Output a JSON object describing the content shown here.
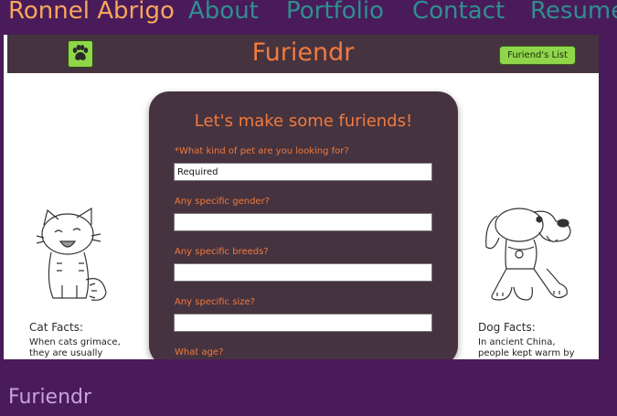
{
  "site": {
    "brand": "Ronnel Abrigo",
    "nav": [
      "About",
      "Portfolio",
      "Contact",
      "Resume"
    ]
  },
  "app": {
    "title": "Furiendr",
    "list_button": "Furiend's List"
  },
  "form": {
    "title": "Let's make some furiends!",
    "fields": [
      {
        "label": "*What kind of pet are you looking for?",
        "value": "Required"
      },
      {
        "label": "Any specific gender?",
        "value": ""
      },
      {
        "label": "Any specific breeds?",
        "value": ""
      },
      {
        "label": "Any specific size?",
        "value": ""
      },
      {
        "label": "What age?",
        "value": ""
      }
    ]
  },
  "cat_facts": {
    "title": "Cat Facts:",
    "text_line1": "When cats grimace,",
    "text_line2": "they are usually"
  },
  "dog_facts": {
    "title": "Dog Facts:",
    "text_line1": "In ancient China,",
    "text_line2": "people kept warm by"
  },
  "footer": {
    "text": "Furiendr"
  }
}
